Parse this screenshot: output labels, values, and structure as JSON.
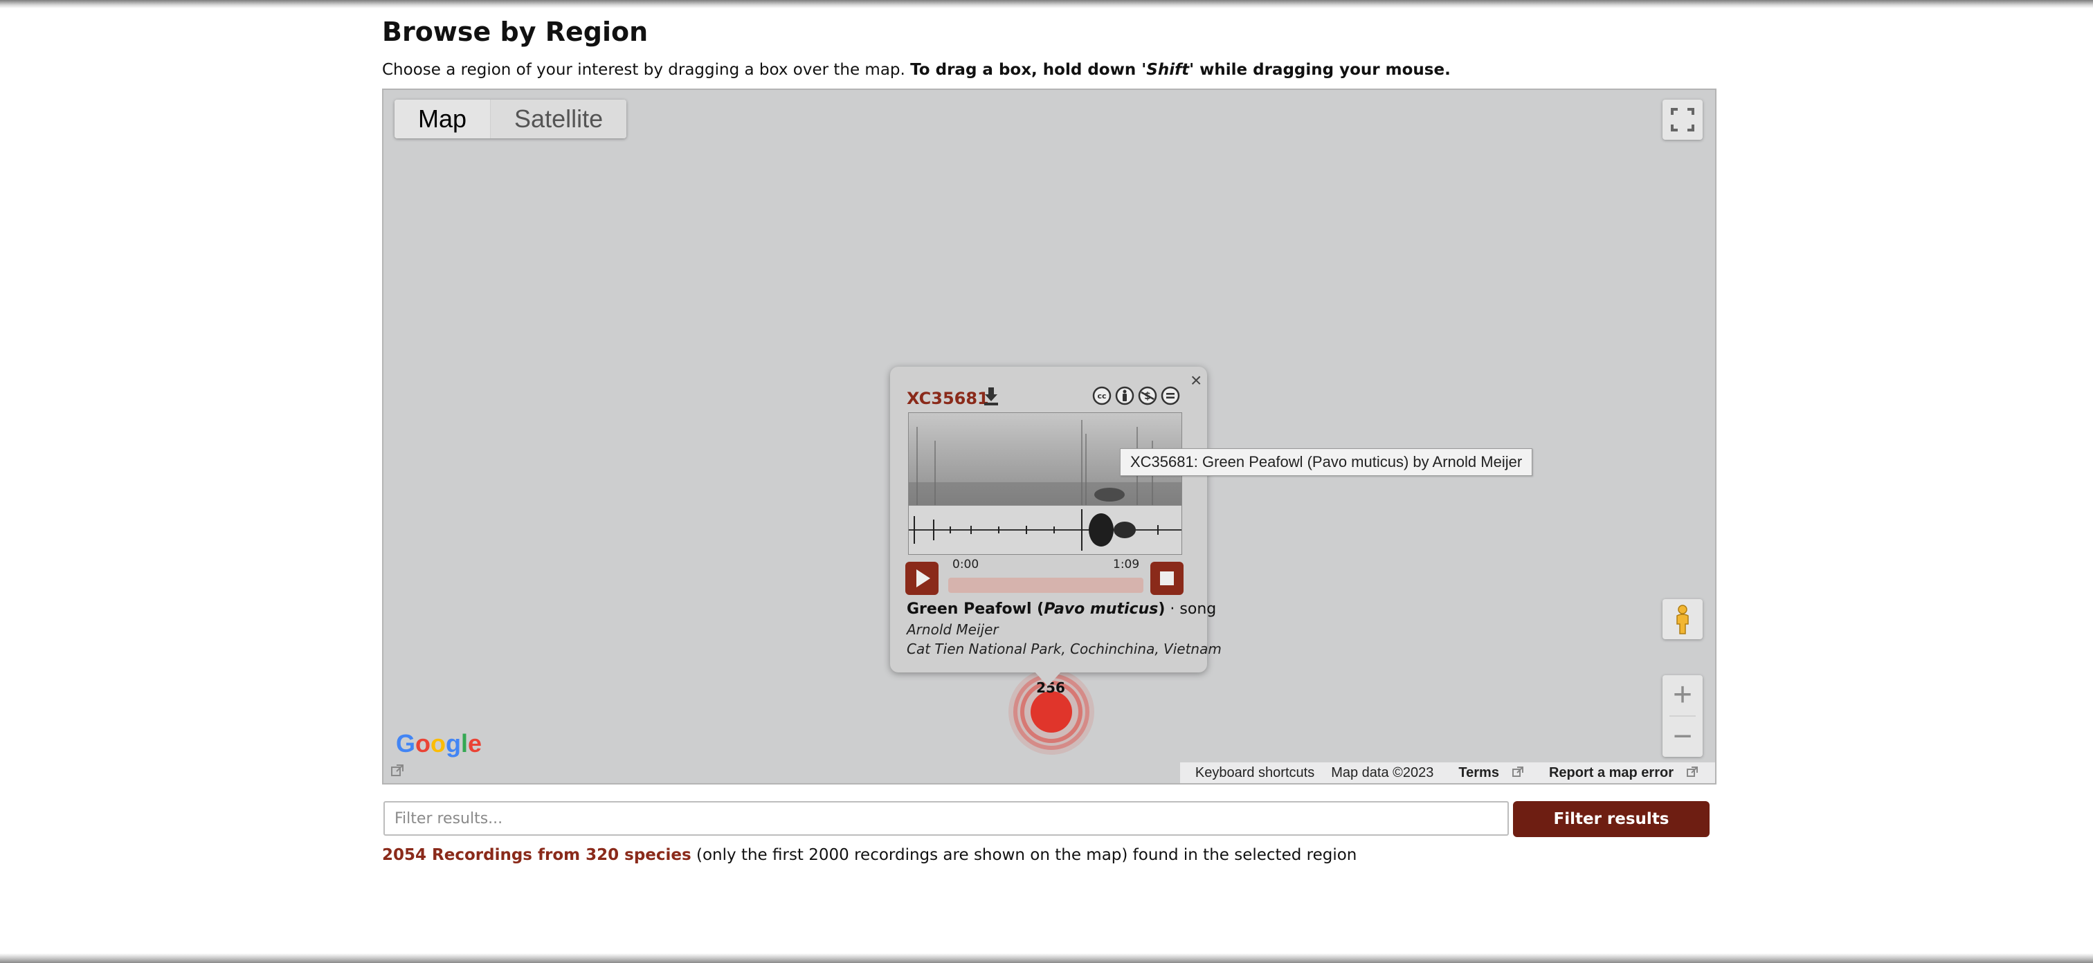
{
  "page": {
    "title": "Browse by Region",
    "instructions_plain": "Choose a region of your interest by dragging a box over the map.",
    "instructions_bold_1": "To drag a box, hold down '",
    "instructions_bold_key": "Shift",
    "instructions_bold_2": "' while dragging your mouse."
  },
  "map": {
    "map_type_options": [
      "Map",
      "Satellite"
    ],
    "selected_map_type": "Map",
    "google_logo": "Google",
    "zoom_in": "+",
    "zoom_out": "−",
    "footer": {
      "keyboard_shortcuts": "Keyboard shortcuts",
      "map_data": "Map data ©2023",
      "terms": "Terms",
      "report_error": "Report a map error"
    },
    "cluster_count": "256",
    "cluster_color": "#e0352b"
  },
  "popup": {
    "close": "×",
    "recording_id": "XC35681",
    "license_icons": [
      "cc-icon",
      "attribution-icon",
      "noncommercial-icon",
      "no-derivatives-icon"
    ],
    "time_start": "0:00",
    "time_end": "1:09",
    "common_name": "Green Peafowl",
    "scientific_name": "Pavo muticus",
    "sound_type": "song",
    "recordist": "Arnold Meijer",
    "location": "Cat Tien National Park, Cochinchina, Vietnam",
    "accent_color": "#8a2a1a"
  },
  "tooltip": "XC35681: Green Peafowl (Pavo muticus) by Arnold Meijer",
  "filter": {
    "placeholder": "Filter results...",
    "value": "",
    "button_label": "Filter results"
  },
  "results": {
    "count_link": "2054 Recordings from 320 species",
    "note": "(only the first 2000 recordings are shown on the map) found in the selected region"
  }
}
